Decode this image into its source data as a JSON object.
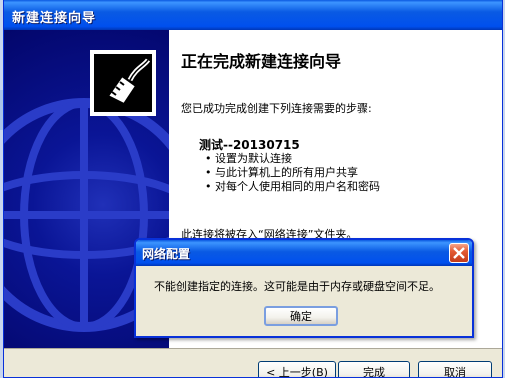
{
  "wizard": {
    "title": "新建连接向导",
    "heading": "正在完成新建连接向导",
    "intro": "您已成功完成创建下列连接需要的步骤:",
    "connection_name": "测试--20130715",
    "bullets": [
      "设置为默认连接",
      "与此计算机上的所有用户共享",
      "对每个人使用相同的用户名和密码"
    ],
    "saved_text": "此连接将被存入“网络连接”文件夹。",
    "buttons": {
      "back": "< 上一步(B)",
      "finish": "完成",
      "cancel": "取消"
    }
  },
  "dialog": {
    "title": "网络配置",
    "message": "不能创建指定的连接。这可能是由于内存或硬盘空间不足。",
    "ok_label": "确定"
  },
  "icons": {
    "wizard_icon": "network-cable-icon",
    "close": "close-icon"
  },
  "colors": {
    "titlebar": "#0a5ae3",
    "left_pane": "#0a1596",
    "close_button": "#e35b34"
  }
}
